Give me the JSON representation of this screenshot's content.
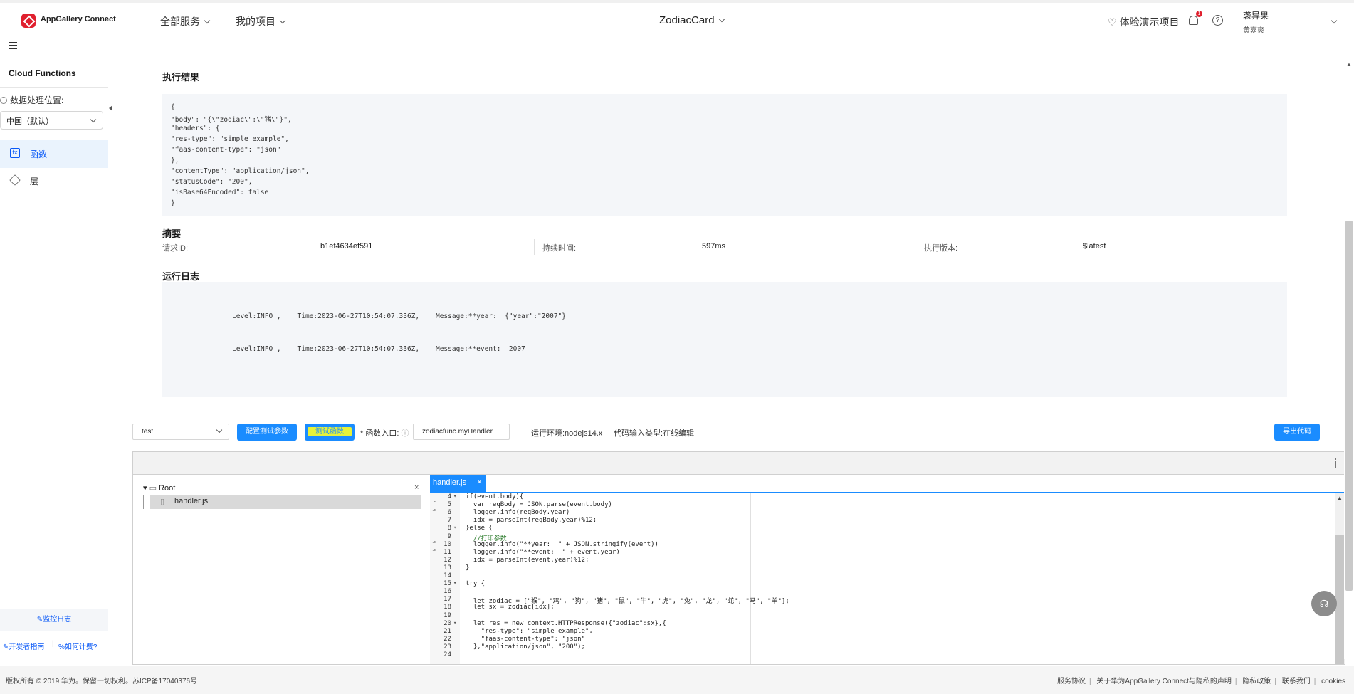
{
  "header": {
    "brand": "AppGallery Connect",
    "nav": [
      "全部服务",
      "我的项目"
    ],
    "project": "ZodiacCard",
    "demo_label": "体验演示项目",
    "notif_count": "1",
    "help": "?",
    "user_name": "袭异果",
    "user_role": "黄嘉爽"
  },
  "sidebar": {
    "title": "Cloud Functions",
    "location_label": "数据处理位置:",
    "location_value": "中国（默认）",
    "items": [
      {
        "label": "函数",
        "icon": "function-icon",
        "active": true
      },
      {
        "label": "层",
        "icon": "layers-icon",
        "active": false
      }
    ],
    "log_link": "监控日志",
    "dev_guide": "开发者指南",
    "pricing": "如何计费?"
  },
  "result": {
    "title": "执行结果",
    "json_lines": [
      "{",
      "\"body\": \"{\\\"zodiac\\\":\\\"猪\\\"}\",",
      "\"headers\": {",
      "\"res-type\": \"simple example\",",
      "\"faas-content-type\": \"json\"",
      "},",
      "\"contentType\": \"application/json\",",
      "\"statusCode\": \"200\",",
      "\"isBase64Encoded\": false",
      "}"
    ]
  },
  "summary": {
    "title": "摘要",
    "request_id_label": "请求ID:",
    "request_id": "b1ef4634ef591",
    "duration_label": "持续时间:",
    "duration": "597ms",
    "version_label": "执行版本:",
    "version": "$latest"
  },
  "logs": {
    "title": "运行日志",
    "lines": [
      "Level:INFO ,    Time:2023-06-27T10:54:07.336Z,    Message:**year:  {\"year\":\"2007\"}",
      "Level:INFO ,    Time:2023-06-27T10:54:07.336Z,    Message:**event:  2007"
    ]
  },
  "toolbar": {
    "test_select": "test",
    "config_button": "配置测试参数",
    "test_button": "测试函数",
    "entry_label": "* 函数入口:",
    "entry_value": "zodiacfunc.myHandler",
    "runtime": "运行环境:nodejs14.x",
    "input_type": "代码输入类型:在线编辑",
    "export_button": "导出代码"
  },
  "editor": {
    "root": "Root",
    "file": "handler.js",
    "tab": "handler.js",
    "lines": [
      {
        "n": "4",
        "fold": "▾",
        "code": "if(event.body){"
      },
      {
        "n": "5",
        "mark": "f",
        "code": "  var reqBody = JSON.parse(event.body)"
      },
      {
        "n": "6",
        "mark": "f",
        "code": "  logger.info(reqBody.year)"
      },
      {
        "n": "7",
        "code": "  idx = parseInt(reqBody.year)%12;"
      },
      {
        "n": "8",
        "fold": "▾",
        "code": "}else {"
      },
      {
        "n": "9",
        "code": "  //打印参数"
      },
      {
        "n": "10",
        "mark": "f",
        "code": "  logger.info(\"**year:  \" + JSON.stringify(event))"
      },
      {
        "n": "11",
        "mark": "f",
        "code": "  logger.info(\"**event:  \" + event.year)"
      },
      {
        "n": "12",
        "code": "  idx = parseInt(event.year)%12;"
      },
      {
        "n": "13",
        "code": "}"
      },
      {
        "n": "14",
        "code": ""
      },
      {
        "n": "15",
        "fold": "▾",
        "code": "try {"
      },
      {
        "n": "16",
        "code": ""
      },
      {
        "n": "17",
        "code": "  let zodiac = [\"猴\", \"鸡\", \"狗\", \"猪\", \"鼠\", \"牛\", \"虎\", \"兔\", \"龙\", \"蛇\", \"马\", \"羊\"];"
      },
      {
        "n": "18",
        "code": "  let sx = zodiac[idx];"
      },
      {
        "n": "19",
        "code": ""
      },
      {
        "n": "20",
        "fold": "▾",
        "code": "  let res = new context.HTTPResponse({\"zodiac\":sx},{"
      },
      {
        "n": "21",
        "code": "    \"res-type\": \"simple example\","
      },
      {
        "n": "22",
        "code": "    \"faas-content-type\": \"json\""
      },
      {
        "n": "23",
        "code": "  },\"application/json\", \"200\");"
      },
      {
        "n": "24",
        "code": ""
      }
    ]
  },
  "footer": {
    "copyright": "版权所有 © 2019 华为。保留一切权利。苏ICP备17040376号",
    "links": [
      "服务协议",
      "关于华为AppGallery Connect与隐私的声明",
      "隐私政策",
      "联系我们",
      "cookies"
    ]
  }
}
